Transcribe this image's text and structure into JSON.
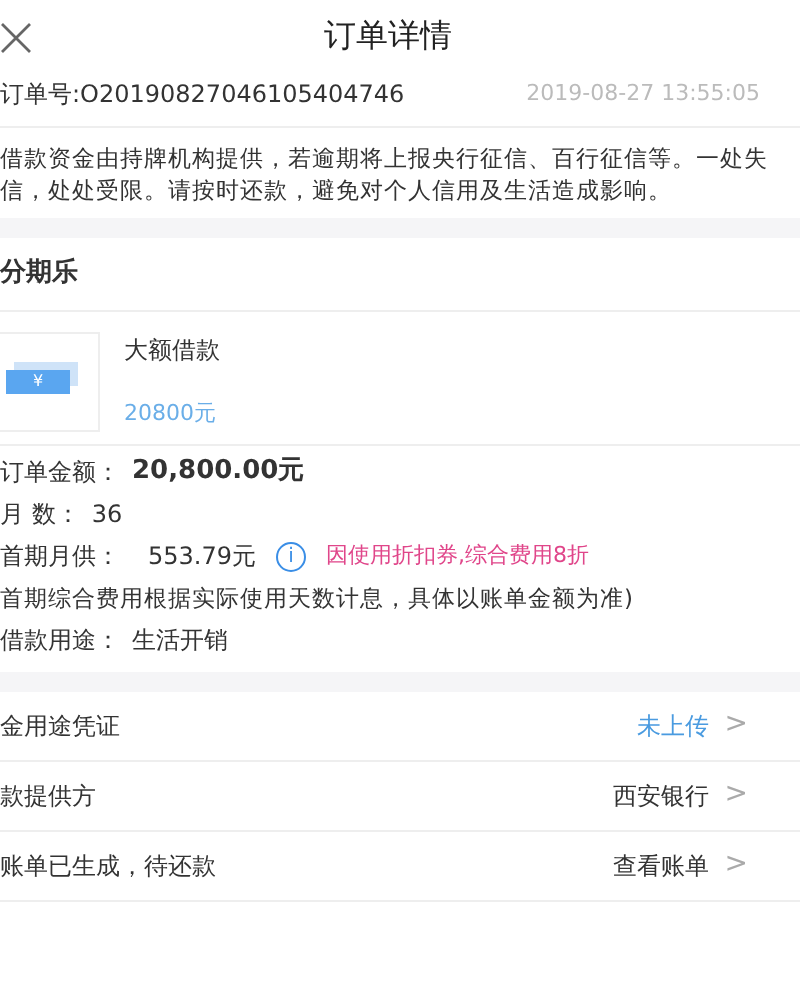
{
  "header": {
    "title": "订单详情"
  },
  "order": {
    "number": "订单号:O20190827046105404746",
    "time": "2019-08-27 13:55:05"
  },
  "notice": "借款资金由持牌机构提供，若逾期将上报央行征信、百行征信等。一处失信，处处受限。请按时还款，避免对个人信用及生活造成影响。",
  "merchant": "分期乐",
  "product": {
    "name": "大额借款",
    "amount": "20800元",
    "thumb_symbol": "¥"
  },
  "details": [
    {
      "kind": "amount",
      "label": "订单金额：",
      "value": "20,800.00元"
    },
    {
      "kind": "plain",
      "label": "月 数：",
      "value": "36"
    },
    {
      "kind": "monthly",
      "label": "首期月供：",
      "value": "553.79元",
      "info": "i",
      "note": "因使用折扣券,综合费用8折"
    },
    {
      "kind": "note",
      "text": "首期综合费用根据实际使用天数计息，具体以账单金额为准)"
    },
    {
      "kind": "plain",
      "label": "借款用途：",
      "value": "生活开销"
    }
  ],
  "links": [
    {
      "label": "金用途凭证",
      "value": "未上传",
      "highlight": true,
      "chevron": ">"
    },
    {
      "label": "款提供方",
      "value": "西安银行",
      "highlight": false,
      "chevron": ">"
    },
    {
      "label": "账单已生成，待还款",
      "value": "查看账单",
      "highlight": false,
      "chevron": ">"
    }
  ]
}
